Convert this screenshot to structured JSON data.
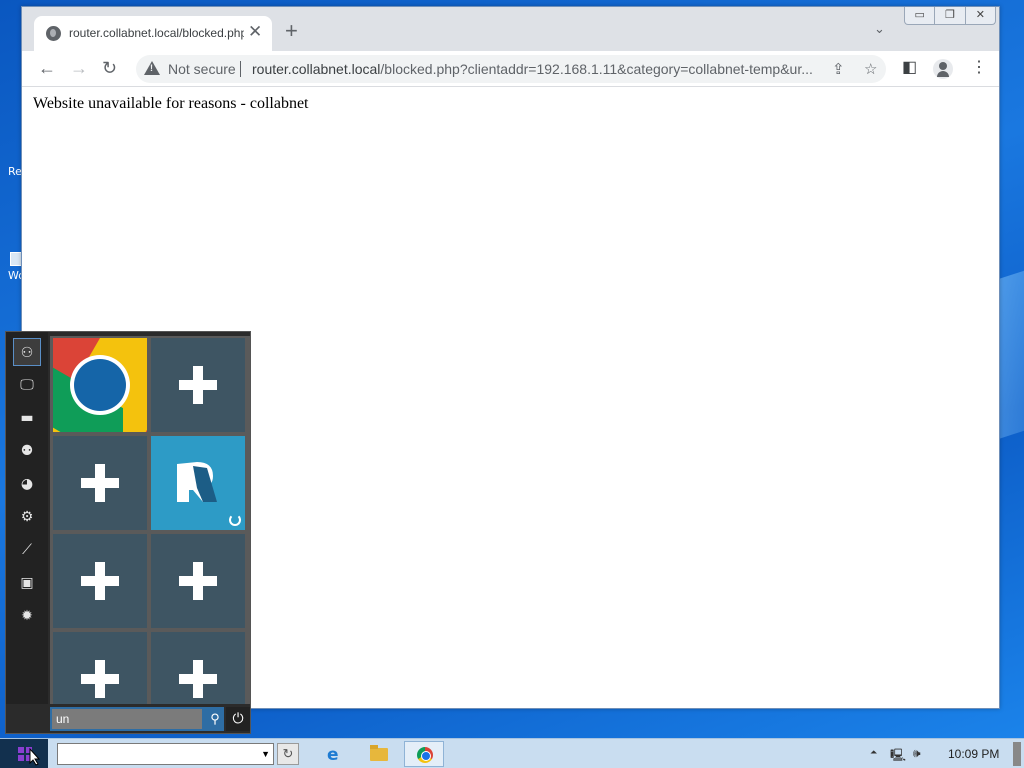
{
  "desktop": {
    "icon_labels": [
      "Re",
      "Wo"
    ]
  },
  "browser": {
    "tab": {
      "title": "router.collabnet.local/blocked.php",
      "close_glyph": "✕"
    },
    "new_tab_glyph": "+",
    "tab_search_glyph": "⌄",
    "window_controls": [
      "▭",
      "❐",
      "✕"
    ],
    "nav": {
      "back": "←",
      "forward": "→",
      "reload": "↻"
    },
    "omnibox": {
      "security_label": "Not secure",
      "url_host": "router.collabnet.local",
      "url_rest": "/blocked.php?clientaddr=192.168.1.11&category=collabnet-temp&ur...",
      "share_glyph": "⇪",
      "bookmark_glyph": "☆"
    },
    "toolbar": {
      "sidepanel_glyph": "◧",
      "menu_glyph": "⋮"
    },
    "page_text": "Website unavailable for reasons - collabnet"
  },
  "start_menu": {
    "rail_icons": [
      {
        "name": "user-icon",
        "glyph": "⚇"
      },
      {
        "name": "monitor-icon",
        "glyph": "🖵"
      },
      {
        "name": "folder-icon",
        "glyph": "▬"
      },
      {
        "name": "users-icon",
        "glyph": "⚉"
      },
      {
        "name": "network-icon",
        "glyph": "◕"
      },
      {
        "name": "settings-gears-icon",
        "glyph": "⚙"
      },
      {
        "name": "chart-icon",
        "glyph": "⟋"
      },
      {
        "name": "display-icon",
        "glyph": "▣"
      },
      {
        "name": "gear-icon",
        "glyph": "✹"
      }
    ],
    "tiles": [
      "chrome",
      "add",
      "add",
      "r-app",
      "add",
      "add",
      "add",
      "add"
    ],
    "search_value": "un",
    "search_glyph": "⚲",
    "power_glyph": "⏻"
  },
  "taskbar": {
    "address_value": "",
    "go_glyph": "↻",
    "tray": {
      "chevron": "⏶",
      "network": "🖳",
      "volume": "🕪"
    },
    "clock": "10:09 PM"
  },
  "colors": {
    "desktop_blue": "#0b62c9",
    "tile_slate": "#3e5563",
    "tile_blue": "#2d9bc6",
    "start_purple": "#8a3fd1"
  }
}
